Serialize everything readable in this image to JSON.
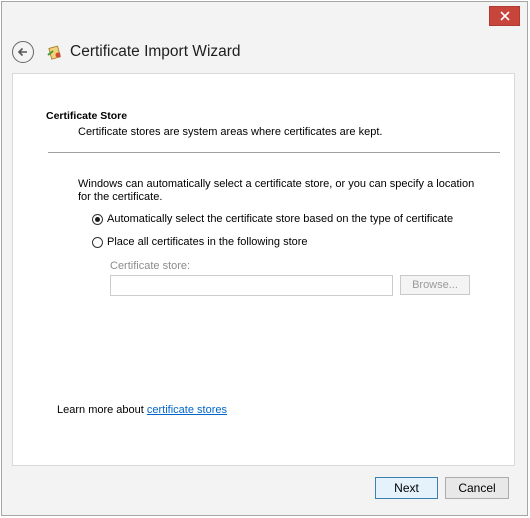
{
  "window": {
    "title": "Certificate Import Wizard",
    "close_icon": "close-icon",
    "back_icon": "back-arrow-icon",
    "wizard_icon": "certificate-icon"
  },
  "section": {
    "title": "Certificate Store",
    "description": "Certificate stores are system areas where certificates are kept."
  },
  "intro": "Windows can automatically select a certificate store, or you can specify a location for the certificate.",
  "options": [
    {
      "label": "Automatically select the certificate store based on the type of certificate",
      "selected": true
    },
    {
      "label": "Place all certificates in the following store",
      "selected": false
    }
  ],
  "store": {
    "label": "Certificate store:",
    "value": "",
    "browse_label": "Browse..."
  },
  "learn_more": {
    "prefix": "Learn more about ",
    "link": "certificate stores"
  },
  "buttons": {
    "next": "Next",
    "cancel": "Cancel"
  },
  "colors": {
    "close": "#c8453c",
    "link": "#0066cc",
    "primary_border": "#3c7fb1"
  }
}
